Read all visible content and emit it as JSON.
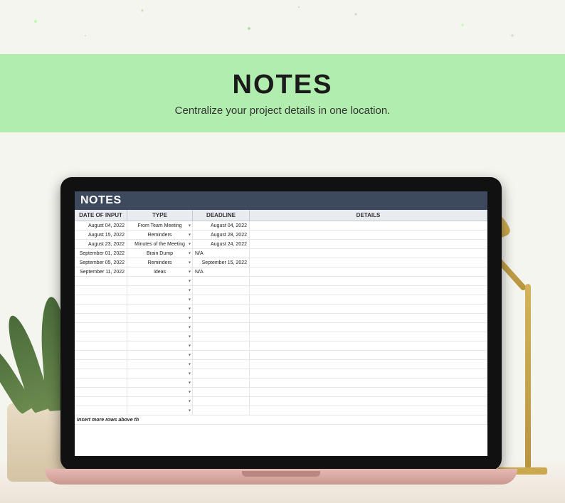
{
  "banner": {
    "title": "NOTES",
    "subtitle": "Centralize your project details in one location."
  },
  "sheet": {
    "title": "NOTES",
    "columns": [
      "DATE OF INPUT",
      "TYPE",
      "DEADLINE",
      "DETAILS"
    ],
    "rows": [
      {
        "date": "August 04, 2022",
        "type": "From Team Meeting",
        "deadline": "August 04, 2022",
        "details": ""
      },
      {
        "date": "August 15, 2022",
        "type": "Reminders",
        "deadline": "August 28, 2022",
        "details": ""
      },
      {
        "date": "August 23, 2022",
        "type": "Minutes of the Meeting",
        "deadline": "August 24, 2022",
        "details": ""
      },
      {
        "date": "September 01, 2022",
        "type": "Brain Dump",
        "deadline": "N/A",
        "details": ""
      },
      {
        "date": "September 05, 2022",
        "type": "Reminders",
        "deadline": "September 15, 2022",
        "details": ""
      },
      {
        "date": "September 11, 2022",
        "type": "Ideas",
        "deadline": "N/A",
        "details": ""
      }
    ],
    "empty_row_count": 15,
    "footer_text": "Insert more rows above th"
  }
}
